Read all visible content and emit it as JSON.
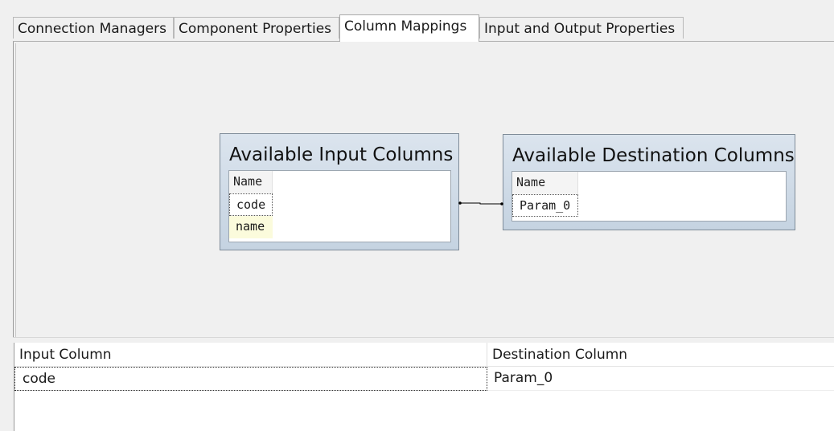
{
  "tabs": [
    {
      "label": "Connection Managers",
      "active": false
    },
    {
      "label": "Component Properties",
      "active": false
    },
    {
      "label": "Column Mappings",
      "active": true
    },
    {
      "label": "Input and Output Properties",
      "active": false
    }
  ],
  "input_box": {
    "title": "Available Input Columns",
    "header": "Name",
    "columns": [
      "code",
      "name"
    ]
  },
  "destination_box": {
    "title": "Available Destination Columns",
    "header": "Name",
    "columns": [
      "Param_0"
    ]
  },
  "grid": {
    "headers": [
      "Input Column",
      "Destination Column"
    ],
    "rows": [
      [
        "code",
        "Param_0"
      ]
    ]
  },
  "colors": {
    "box_gradient_top": "#dbe4ee",
    "box_gradient_bottom": "#c5d3e1",
    "highlight_row": "#fbfbdc",
    "background": "#f0f0f0"
  }
}
